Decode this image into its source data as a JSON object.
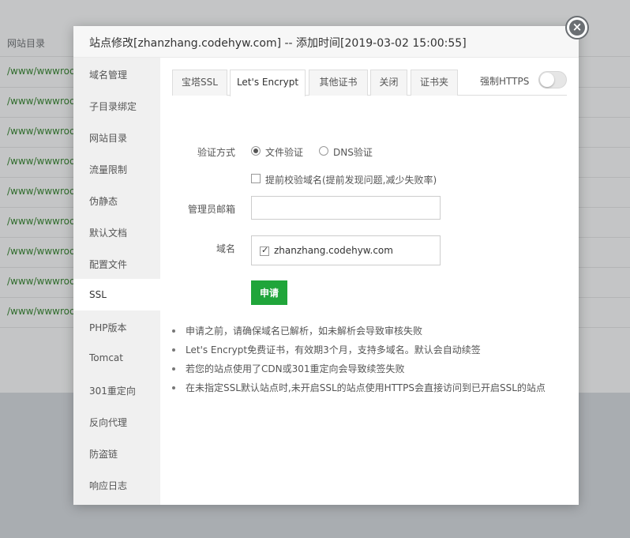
{
  "background": {
    "header_label": "网站目录",
    "row_path": "/www/wwwroo",
    "row_count": 9
  },
  "modal": {
    "title": "站点修改[zhanzhang.codehyw.com] -- 添加时间[2019-03-02 15:00:55]",
    "close_icon": "×"
  },
  "sidebar": {
    "items": [
      {
        "label": "域名管理"
      },
      {
        "label": "子目录绑定"
      },
      {
        "label": "网站目录"
      },
      {
        "label": "流量限制"
      },
      {
        "label": "伪静态"
      },
      {
        "label": "默认文档"
      },
      {
        "label": "配置文件"
      },
      {
        "label": "SSL",
        "active": true
      },
      {
        "label": "PHP版本"
      },
      {
        "label": "Tomcat"
      },
      {
        "label": "301重定向"
      },
      {
        "label": "反向代理"
      },
      {
        "label": "防盗链"
      },
      {
        "label": "响应日志"
      }
    ]
  },
  "tabs": [
    {
      "label": "宝塔SSL"
    },
    {
      "label": "Let's Encrypt",
      "active": true
    },
    {
      "label": "其他证书"
    },
    {
      "label": "关闭"
    },
    {
      "label": "证书夹"
    }
  ],
  "force_https": {
    "label": "强制HTTPS",
    "enabled": false
  },
  "form": {
    "verify_label": "验证方式",
    "verify_options": [
      {
        "label": "文件验证",
        "checked": true
      },
      {
        "label": "DNS验证",
        "checked": false
      }
    ],
    "precheck_label": "提前校验域名(提前发现问题,减少失败率)",
    "precheck_checked": false,
    "email_label": "管理员邮箱",
    "email_value": "",
    "domain_label": "域名",
    "domain_value": "zhanzhang.codehyw.com",
    "domain_checked": true,
    "apply_label": "申请"
  },
  "notes": [
    "申请之前，请确保域名已解析，如未解析会导致审核失败",
    "Let's Encrypt免费证书，有效期3个月，支持多域名。默认会自动续签",
    "若您的站点使用了CDN或301重定向会导致续签失败",
    "在未指定SSL默认站点时,未开启SSL的站点使用HTTPS会直接访问到已开启SSL的站点"
  ],
  "colors": {
    "accent": "#20a53a",
    "path_green": "#2f6c2b"
  }
}
